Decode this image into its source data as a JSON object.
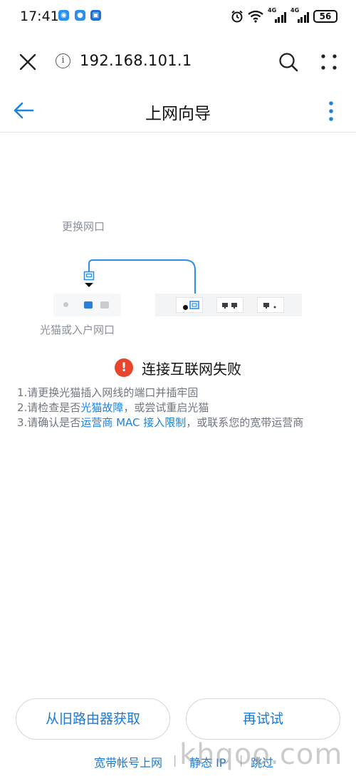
{
  "status_bar": {
    "time": "17:41",
    "network_1": "4G",
    "network_2": "4G",
    "battery": "56"
  },
  "browser": {
    "url": "192.168.101.1",
    "info_symbol": "i"
  },
  "header": {
    "title": "上网向导"
  },
  "diagram": {
    "change_port_label": "更换网口",
    "modem_label": "光猫或入户网口"
  },
  "error": {
    "icon": "!",
    "message": "连接互联网失败"
  },
  "tips": {
    "t1": "1.请更换光猫插入网线的端口并插牢固",
    "t2_prefix": "2.请检查是否",
    "t2_link": "光猫故障",
    "t2_suffix": "，或尝试重启光猫",
    "t3_prefix": "3.请确认是否",
    "t3_link": "运营商 MAC 接入限制",
    "t3_suffix": "，或联系您的宽带运营商"
  },
  "buttons": {
    "old_router": "从旧路由器获取",
    "retry": "再试试"
  },
  "footer": {
    "broadband": "宽带帐号上网",
    "static_ip": "静态 IP",
    "skip": "跳过",
    "separator": "|",
    "watermark": "khqoo.com"
  },
  "colors": {
    "accent": "#1a7ad8",
    "error": "#e8452c",
    "cable": "#2b8ff0"
  }
}
